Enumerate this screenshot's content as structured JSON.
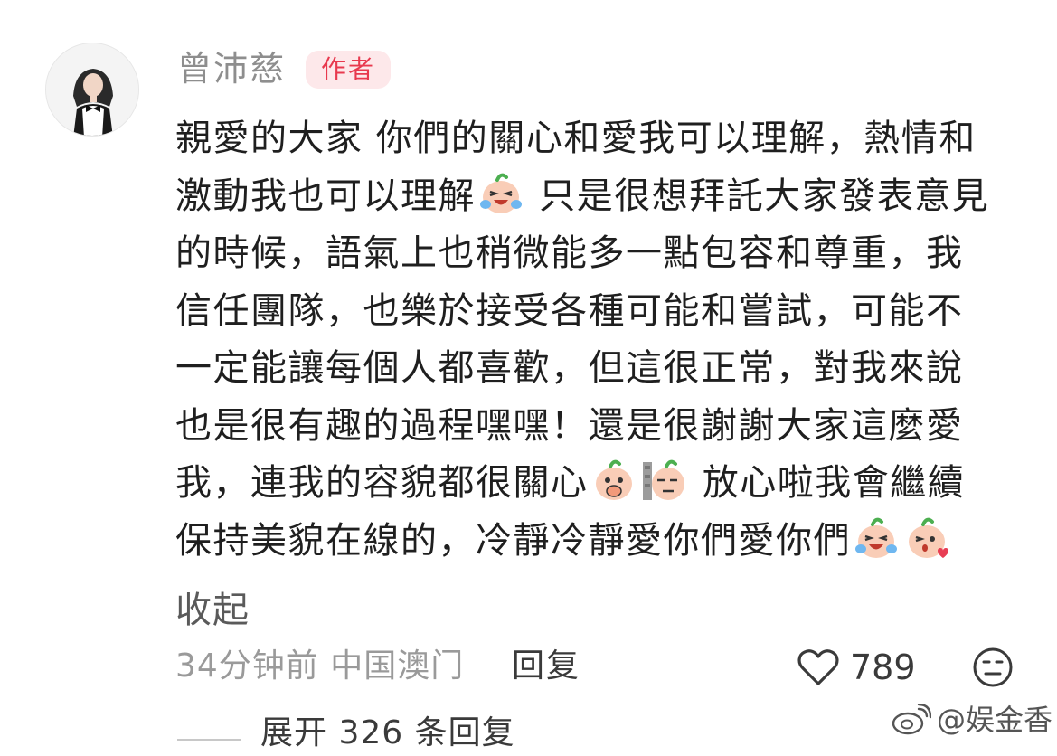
{
  "comment": {
    "author": "曾沛慈",
    "author_badge": "作者",
    "lines": [
      {
        "segments": [
          {
            "t": "親愛的大家 你們的關心和愛我可以理解，熱情和"
          }
        ]
      },
      {
        "segments": [
          {
            "t": "激動我也可以理解"
          },
          {
            "emoji": "crying-laugh"
          },
          {
            "t": " 只是很想拜託大家發表意見"
          }
        ]
      },
      {
        "segments": [
          {
            "t": "的時候，語氣上也稍微能多一點包容和尊重，我"
          }
        ]
      },
      {
        "segments": [
          {
            "t": "信任團隊，也樂於接受各種可能和嘗試，可能不"
          }
        ]
      },
      {
        "segments": [
          {
            "t": "一定能讓每個人都喜歡，但這很正常，對我來說"
          }
        ]
      },
      {
        "segments": [
          {
            "t": "也是很有趣的過程嘿嘿！還是很謝謝大家這麼愛"
          }
        ]
      },
      {
        "segments": [
          {
            "t": "我，連我的容貌都很關心"
          },
          {
            "emoji": "thinking"
          },
          {
            "emoji": "peeking"
          },
          {
            "t": " 放心啦我會繼續"
          }
        ]
      },
      {
        "segments": [
          {
            "t": "保持美貌在線的，冷靜冷靜愛你們愛你們"
          },
          {
            "emoji": "crying-laugh"
          },
          {
            "emoji": "kiss"
          }
        ]
      }
    ],
    "collapse_label": "收起",
    "time_location": "34分钟前 中国澳门",
    "reply_label": "回复",
    "like_count": "789",
    "expand_replies_label": "展开 326 条回复"
  },
  "watermark": "@娱金香",
  "icons": {
    "like": "heart-outline-icon",
    "dislike": "neutral-face-icon",
    "watermark": "weibo-logo-icon"
  },
  "colors": {
    "author_badge_bg": "#fde8ea",
    "author_badge_text": "#e8394e",
    "meta_text": "#9a9a9a",
    "body_text": "#1f1f1f"
  }
}
